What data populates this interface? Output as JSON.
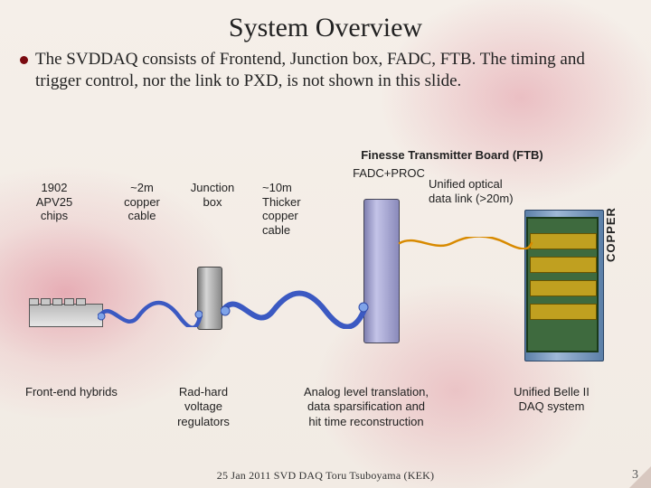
{
  "title": "System Overview",
  "bullet": "The SVDDAQ consists of Frontend, Junction box, FADC, FTB. The timing and trigger control, nor the link to PXD, is not shown in this slide.",
  "ftb_label": "Finesse Transmitter Board (FTB)",
  "labels": {
    "chips": "1902\nAPV25\nchips",
    "cable1": "~2m\ncopper\ncable",
    "junction": "Junction\nbox",
    "cable2": "~10m\nThicker\ncopper\ncable",
    "fadc": "FADC+PROC",
    "optical": "Unified optical\ndata link (>20m)",
    "copper_vert": "COPPER"
  },
  "bottom": {
    "frontend": "Front-end hybrids",
    "radhard": "Rad-hard\nvoltage\nregulators",
    "analog": "Analog level translation,\ndata sparsification and\nhit time reconstruction",
    "belle": "Unified Belle II\nDAQ system"
  },
  "footer": "25 Jan 2011 SVD DAQ Toru Tsuboyama (KEK)",
  "page": "3"
}
